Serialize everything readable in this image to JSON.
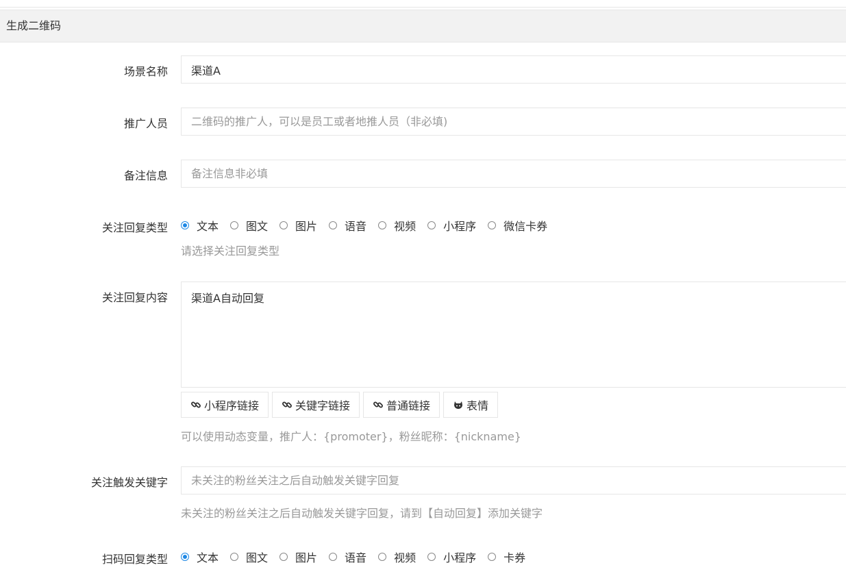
{
  "panel": {
    "title": "生成二维码"
  },
  "form": {
    "scene_name": {
      "label": "场景名称",
      "value": "渠道A"
    },
    "promoter": {
      "label": "推广人员",
      "placeholder": "二维码的推广人，可以是员工或者地推人员（非必填)"
    },
    "remark": {
      "label": "备注信息",
      "placeholder": "备注信息非必填"
    },
    "follow_reply_type": {
      "label": "关注回复类型",
      "options": [
        "文本",
        "图文",
        "图片",
        "语音",
        "视频",
        "小程序",
        "微信卡券"
      ],
      "selected": "文本",
      "help": "请选择关注回复类型"
    },
    "follow_reply_content": {
      "label": "关注回复内容",
      "value": "渠道A自动回复",
      "buttons": [
        {
          "label": "小程序链接",
          "icon": "link-icon"
        },
        {
          "label": "关键字链接",
          "icon": "link-icon"
        },
        {
          "label": "普通链接",
          "icon": "link-icon"
        },
        {
          "label": "表情",
          "icon": "emoji-icon"
        }
      ],
      "help": "可以使用动态变量，推广人：{promoter}，粉丝昵称：{nickname}"
    },
    "follow_keyword": {
      "label": "关注触发关键字",
      "placeholder": "未关注的粉丝关注之后自动触发关键字回复",
      "help": "未关注的粉丝关注之后自动触发关键字回复，请到【自动回复】添加关键字"
    },
    "scan_reply_type": {
      "label": "扫码回复类型",
      "options": [
        "文本",
        "图文",
        "图片",
        "语音",
        "视频",
        "小程序",
        "卡券"
      ],
      "selected": "文本"
    }
  },
  "colors": {
    "accent": "#1e88e5",
    "border": "#e6e6e6",
    "help": "#999999"
  }
}
